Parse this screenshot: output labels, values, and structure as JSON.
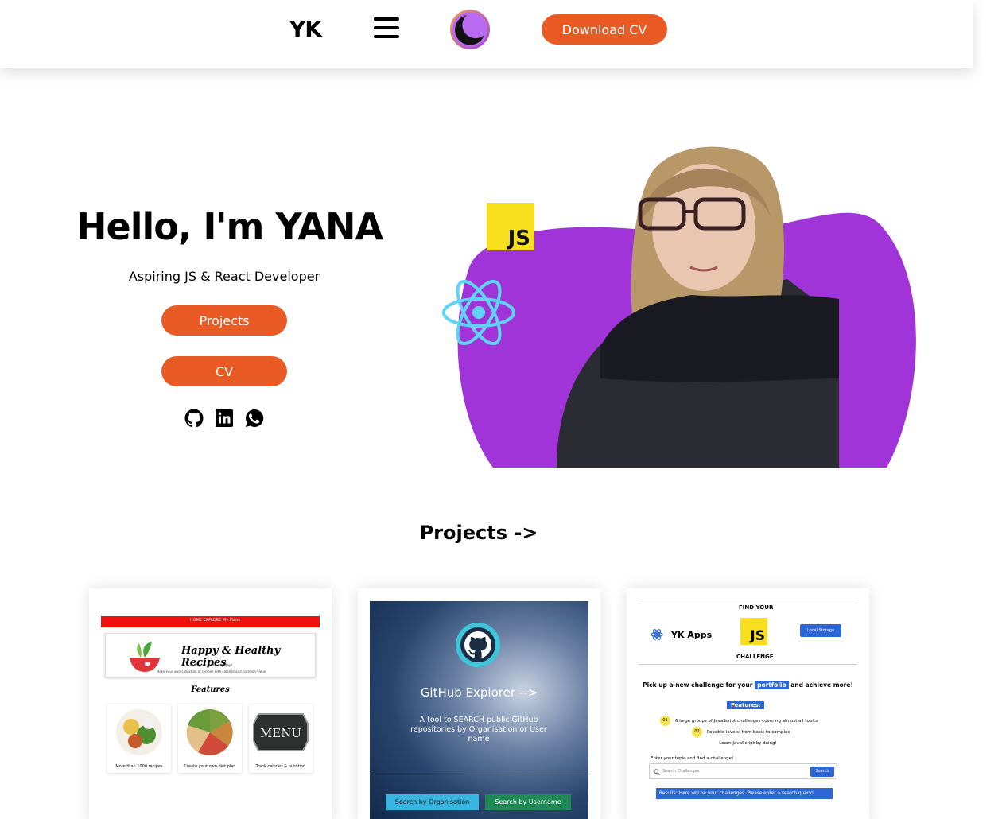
{
  "header": {
    "logo": "YK",
    "download_label": "Download CV"
  },
  "hero": {
    "title": "Hello, I'm YANA",
    "subtitle": "Aspiring JS & React Developer",
    "projects_label": "Projects",
    "cv_label": "CV",
    "js_badge": "JS"
  },
  "projects": {
    "title": "Projects ->",
    "cards": [
      {
        "nav": "HOME   EXPLORE   My Plans",
        "banner_title": "Happy & Healthy Recipes",
        "banner_tag": "Love your food every day!",
        "banner_desc": "Make your own collection of recipes with calories and nutrition value",
        "features": "Features",
        "items": [
          "More than 1000 recipes",
          "Create your own diet plan",
          "Track calories & nutrition"
        ],
        "menu_text": "MENU"
      },
      {
        "title": "GitHub Explorer -->",
        "desc": "A tool to SEARCH public GitHub repositories by Organisation or User name",
        "btn1": "Search by Organisation",
        "btn2": "Search by Username"
      },
      {
        "find": "FIND YOUR",
        "brand": "YK Apps",
        "js": "JS",
        "challenge": "CHALLENGE",
        "local": "Local Storage",
        "pick_before": "Pick up a new challenge for your",
        "pick_hl": "portfolio",
        "pick_after": "and achieve more!",
        "features": "Features:",
        "f1_num": "01",
        "f1": "6 large groups of JavaScript challenges covering almost all topics",
        "f2_num": "02",
        "f2": "Possible levels: from basic to complex",
        "learn": "Learn JavaScript by doing!",
        "enter": "Enter your topic and find a challenge!",
        "search_placeholder": "Search Challenges",
        "search_btn": "Search",
        "results": "Results: Here will be your challenges. Please enter a search query!"
      }
    ]
  },
  "colors": {
    "accent": "#e95a24",
    "purple": "#a034d8",
    "js_yellow": "#f7df1e",
    "react_cyan": "#5fd4f4"
  },
  "icons": [
    "hamburger-menu-icon",
    "moon-icon",
    "github-icon",
    "linkedin-icon",
    "whatsapp-icon",
    "react-icon",
    "js-icon"
  ]
}
